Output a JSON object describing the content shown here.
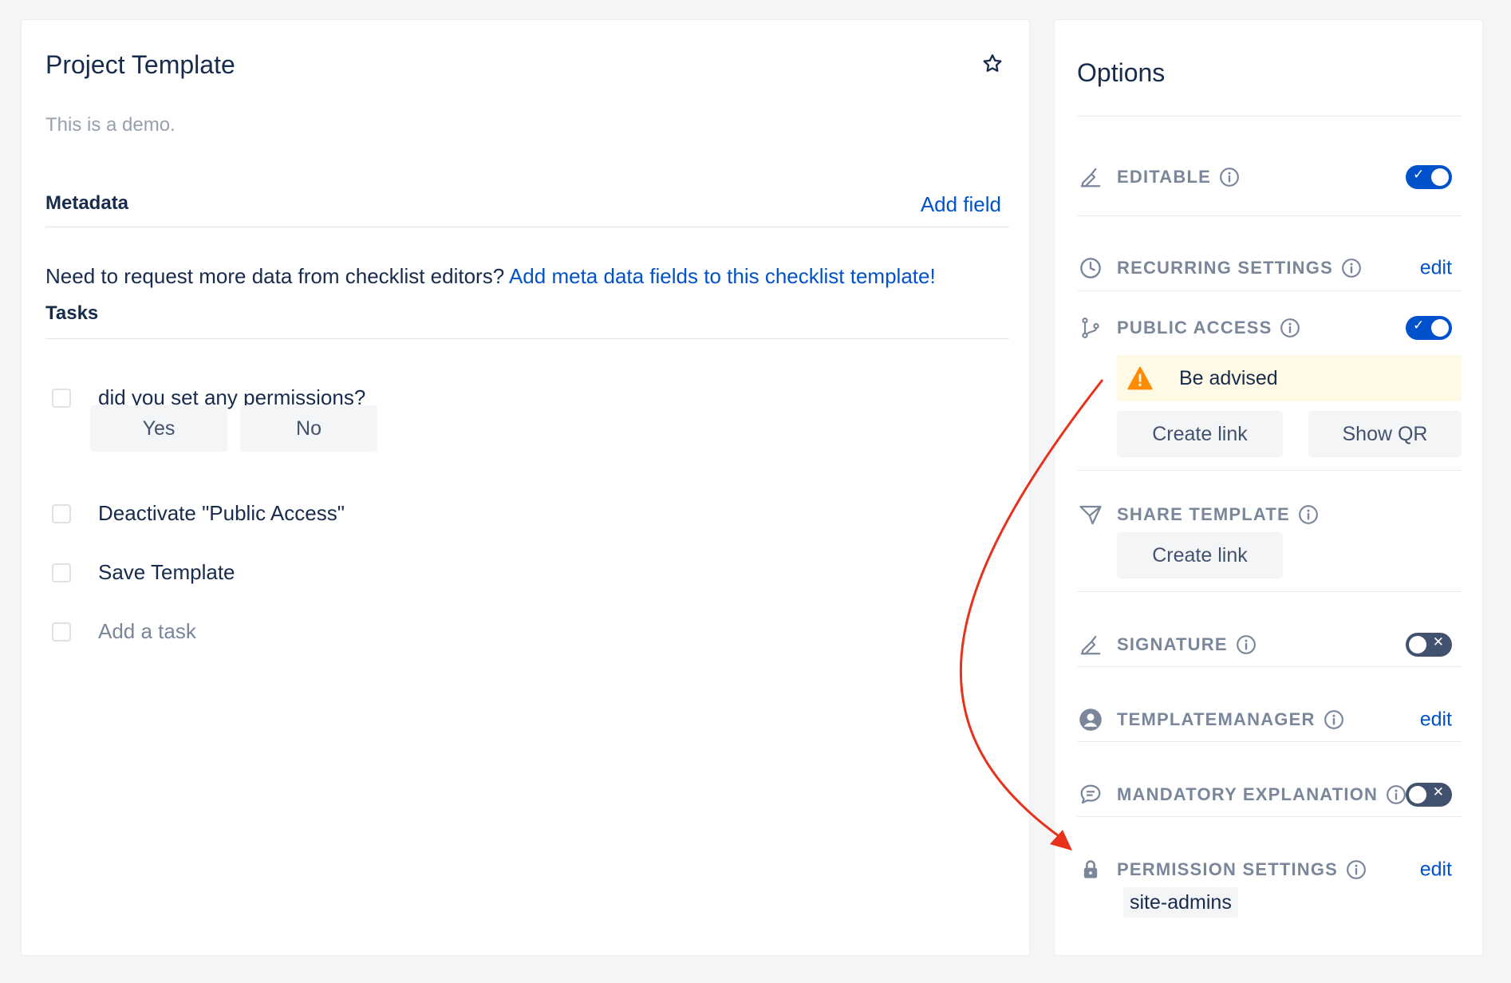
{
  "template": {
    "title": "Project Template",
    "description": "This is a demo.",
    "metadata_heading": "Metadata",
    "add_field_label": "Add field",
    "metadata_hint": "Need to request more data from checklist editors?",
    "metadata_hint_link": "Add meta data fields to this checklist template!",
    "tasks_heading": "Tasks",
    "tasks": [
      {
        "label": "did you set any permissions?",
        "checked": false
      },
      {
        "label": "Deactivate \"Public Access\"",
        "checked": false
      },
      {
        "label": "Save Template",
        "checked": false
      }
    ],
    "answers": {
      "yes": "Yes",
      "no": "No"
    },
    "add_task_placeholder": "Add a task"
  },
  "options": {
    "title": "Options",
    "rows": {
      "editable": {
        "label": "EDITABLE",
        "icon": "signature-pen-icon",
        "enabled": true
      },
      "recurring": {
        "label": "RECURRING SETTINGS",
        "icon": "clock-icon",
        "action": "edit"
      },
      "public_access": {
        "label": "PUBLIC ACCESS",
        "icon": "branch-icon",
        "enabled": true
      },
      "share_template": {
        "label": "SHARE TEMPLATE",
        "icon": "paper-plane-icon"
      },
      "signature": {
        "label": "SIGNATURE",
        "icon": "signature-pen-icon",
        "enabled": false
      },
      "template_manager": {
        "label": "TEMPLATEMANAGER",
        "icon": "user-circle-icon",
        "action": "edit"
      },
      "mandatory_explanation": {
        "label": "MANDATORY EXPLANATION",
        "icon": "comment-icon",
        "enabled": false
      },
      "permission_settings": {
        "label": "PERMISSION SETTINGS",
        "icon": "lock-icon",
        "action": "edit"
      }
    },
    "advisory": {
      "text": "Be advised",
      "icon": "warning-icon",
      "color": "#ff8b00"
    },
    "buttons": {
      "create_link": "Create link",
      "show_qr": "Show QR",
      "share_create_link": "Create link"
    },
    "permission_tag": "site-admins"
  },
  "colors": {
    "accent": "#0052cc",
    "toggle_off": "#42526e",
    "warning": "#ff8b00",
    "annotation_arrow": "#e8311a"
  }
}
